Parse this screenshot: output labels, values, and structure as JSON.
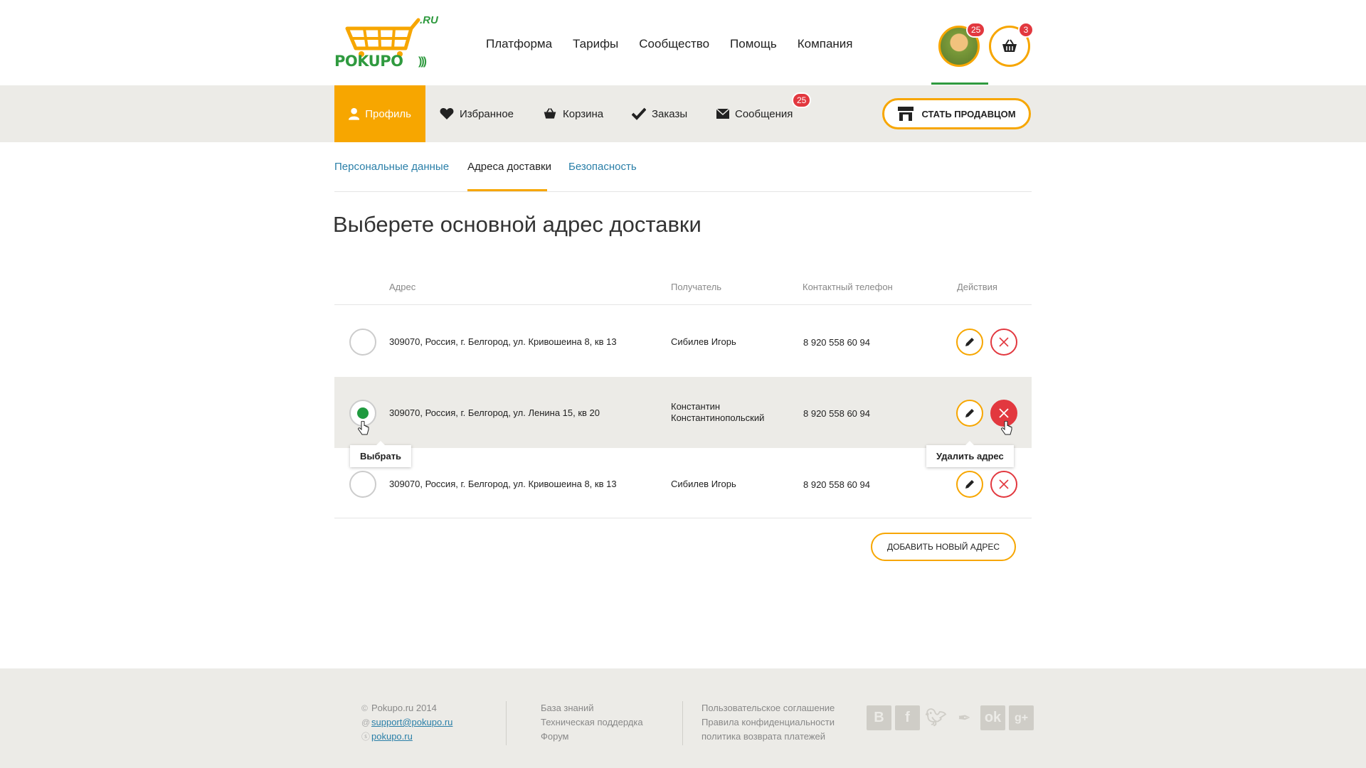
{
  "header": {
    "logo": {
      "main": "POKUPO",
      "suffix": ".RU"
    },
    "nav": [
      "Платформа",
      "Тарифы",
      "Сообщество",
      "Помощь",
      "Компания"
    ],
    "avatar_badge": "25",
    "cart_badge": "3"
  },
  "subnav": {
    "items": [
      {
        "label": "Профиль",
        "icon": "user-icon"
      },
      {
        "label": "Избранное",
        "icon": "heart-icon"
      },
      {
        "label": "Корзина",
        "icon": "basket-icon"
      },
      {
        "label": "Заказы",
        "icon": "check-icon"
      },
      {
        "label": "Сообщения",
        "icon": "envelope-icon",
        "badge": "25"
      }
    ],
    "seller_button": "СТАТЬ ПРОДАВЦОМ"
  },
  "tabs": [
    "Персональные данные",
    "Адреса доставки",
    "Безопасность"
  ],
  "page_title": "Выберете основной адрес доставки",
  "table": {
    "headers": [
      "Адрес",
      "Получатель",
      "Контактный телефон",
      "Действия"
    ],
    "rows": [
      {
        "address": "309070, Россия, г. Белгород, ул. Кривошеина 8, кв 13",
        "recipient_line1": "Сибилев Игорь",
        "recipient_line2": "",
        "phone": "8 920 558 60 94",
        "selected": false
      },
      {
        "address": "309070, Россия, г. Белгород, ул. Ленина 15, кв 20",
        "recipient_line1": "Константин",
        "recipient_line2": "Константинопольский",
        "phone": "8 920 558 60 94",
        "selected": true
      },
      {
        "address": "309070, Россия, г. Белгород, ул. Кривошеина 8, кв 13",
        "recipient_line1": "Сибилев Игорь",
        "recipient_line2": "",
        "phone": "8 920 558 60 94",
        "selected": false
      }
    ]
  },
  "tooltips": {
    "select": "Выбрать",
    "delete": "Удалить адрес"
  },
  "add_button": "ДОБАВИТЬ НОВЫЙ АДРЕС",
  "footer": {
    "copyright": "Pokupo.ru 2014",
    "email": "support@pokupo.ru",
    "skype": "pokupo.ru",
    "links_col2": [
      "База знаний",
      "Техническая поддердка",
      "Форум"
    ],
    "links_col3": [
      "Пользовательское соглашение",
      "Правила конфиденциальности",
      "политика возврата платежей"
    ],
    "social": [
      "vk-icon",
      "facebook-icon",
      "twitter-icon",
      "feather-icon",
      "odnoklassniki-icon",
      "googleplus-icon"
    ]
  },
  "colors": {
    "accent": "#f7a600",
    "green": "#1f9a3f",
    "danger": "#e2383f",
    "link": "#2a7fa8",
    "band": "#ecebe7"
  }
}
